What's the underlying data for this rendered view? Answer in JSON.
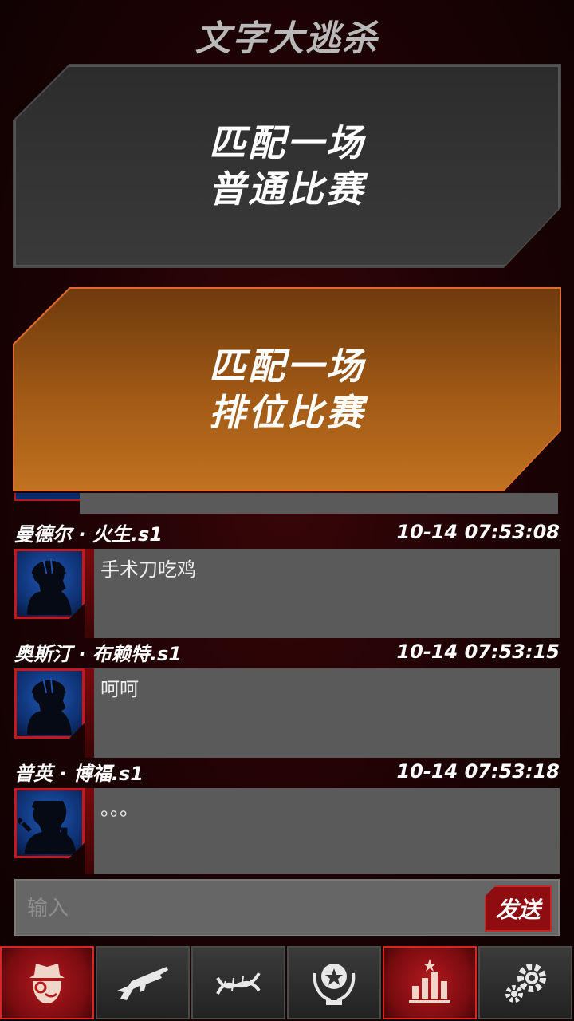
{
  "title": "文字大逃杀",
  "match_normal": {
    "line1": "匹配一场",
    "line2": "普通比赛"
  },
  "match_ranked": {
    "line1": "匹配一场",
    "line2": "排位比赛"
  },
  "messages": [
    {
      "name": "曼德尔 · 火生.s1",
      "time": "10-14 07:53:08",
      "text": "手术刀吃鸡",
      "avatar": "hardhat-worker-icon"
    },
    {
      "name": "奥斯汀 · 布赖特.s1",
      "time": "10-14 07:53:15",
      "text": "呵呵",
      "avatar": "hardhat-worker-icon"
    },
    {
      "name": "普英 · 博福.s1",
      "time": "10-14 07:53:18",
      "text": "。。。",
      "avatar": "mechanic-wrench-icon"
    }
  ],
  "input": {
    "placeholder": "输入",
    "send_label": "发送"
  },
  "nav": [
    {
      "icon": "spy-detective-icon",
      "active": true
    },
    {
      "icon": "rifle-icon",
      "active": false
    },
    {
      "icon": "dna-icon",
      "active": false
    },
    {
      "icon": "trophy-laurel-icon",
      "active": false
    },
    {
      "icon": "leaderboard-icon",
      "active": true
    },
    {
      "icon": "settings-gears-icon",
      "active": false
    }
  ],
  "colors": {
    "accent_red": "#c8161b",
    "ranked_orange": "#c0721f",
    "bubble_gray": "#5a5a5a"
  }
}
